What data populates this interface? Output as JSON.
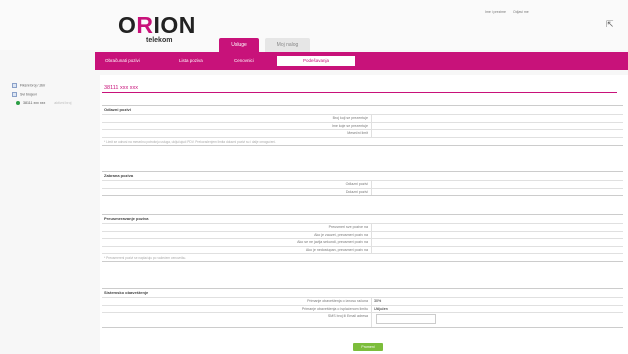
{
  "header": {
    "logo_text_start": "O",
    "logo_text_r": "R",
    "logo_text_end": "ION",
    "logo_sub": "telekom",
    "top_links": [
      "Ime i prezime",
      "Odjavi me"
    ],
    "tabs": [
      {
        "label": "Usluge",
        "active": true
      },
      {
        "label": "Moj nalog",
        "active": false
      }
    ]
  },
  "navbar": {
    "items": [
      {
        "label": "Obračunati pozivi",
        "active": false
      },
      {
        "label": "Lista poziva",
        "active": false
      },
      {
        "label": "Cenovnici",
        "active": false
      },
      {
        "label": "Podešavanja",
        "active": true
      }
    ]
  },
  "sidebar": {
    "items": [
      {
        "label": "Fiksni broj / zbir"
      },
      {
        "label": "Svi brojevi"
      },
      {
        "label": "38111 xxx xxx",
        "extra": "aktivni broj"
      }
    ]
  },
  "main": {
    "phone_title": "38111 xxx xxx",
    "sections": [
      {
        "title": "Odlazni pozivi",
        "rows": [
          {
            "label": "Broj koji se prezentuje",
            "value": ""
          },
          {
            "label": "Ime koje se prezentuje",
            "value": ""
          },
          {
            "label": "Mesečni limit",
            "value": ""
          }
        ],
        "note": "* Limit se odnosi na mesečnu potrošnju usluga, uključujući PDV. Prekoračenjem limita dolazni pozivi su i dalje omogućeni."
      },
      {
        "title": "Zabrana poziva",
        "rows": [
          {
            "label": "Odlazni pozivi",
            "value": ""
          },
          {
            "label": "Dolazni pozivi",
            "value": ""
          }
        ]
      },
      {
        "title": "Preusmeravanje poziva",
        "rows": [
          {
            "label": "Preusmeri sve pozive na",
            "value": ""
          },
          {
            "label": "Ako je zauzet, preusmeri poziv na",
            "value": ""
          },
          {
            "label": "Ako se ne javlja sekundi, preusmeri poziv na",
            "value": ""
          },
          {
            "label": "Ako je nedostupan, preusmeri poziv na",
            "value": ""
          }
        ],
        "note": "* Preusmereni pozivi se naplaćuju po važećem cenovniku."
      },
      {
        "title": "Sistemsko obaveštenje",
        "rows": [
          {
            "label": "Primanje obaveštenja o iznosu računa",
            "value": "30%"
          },
          {
            "label": "Primanje obaveštenja o isplaćenom limitu",
            "value": "Uključen"
          },
          {
            "label": "SMS broj ili Email adresa",
            "value": ""
          }
        ]
      }
    ],
    "save_label": "Promeni"
  }
}
